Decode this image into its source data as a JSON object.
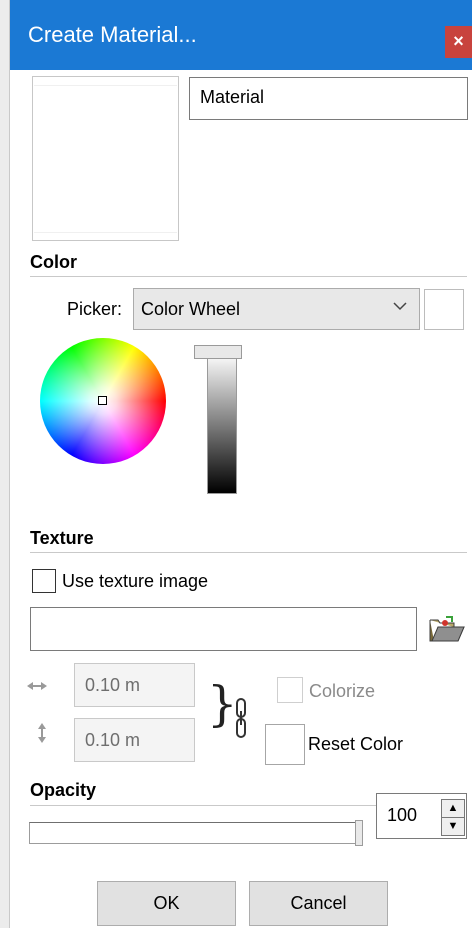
{
  "window": {
    "title": "Create Material...",
    "close_glyph": "×",
    "accent_color": "#1b79d4",
    "close_color": "#c8433d"
  },
  "material": {
    "name_value": "Material",
    "preview_color": "#ffffff"
  },
  "color": {
    "section_title": "Color",
    "picker_label": "Picker:",
    "picker_value": "Color Wheel",
    "selected_color": "#ffffff",
    "brightness_level": 1.0
  },
  "texture": {
    "section_title": "Texture",
    "use_texture_label": "Use texture image",
    "use_texture_checked": false,
    "path_value": "",
    "width_value": "0.10 m",
    "height_value": "0.10 m",
    "colorize_label": "Colorize",
    "reset_color_label": "Reset Color",
    "icons": [
      "folder-open-icon",
      "width-arrow-icon",
      "height-arrow-icon",
      "chain-link-icon"
    ]
  },
  "opacity": {
    "section_title": "Opacity",
    "value": "100",
    "level": 1.0
  },
  "buttons": {
    "ok_label": "OK",
    "cancel_label": "Cancel"
  }
}
